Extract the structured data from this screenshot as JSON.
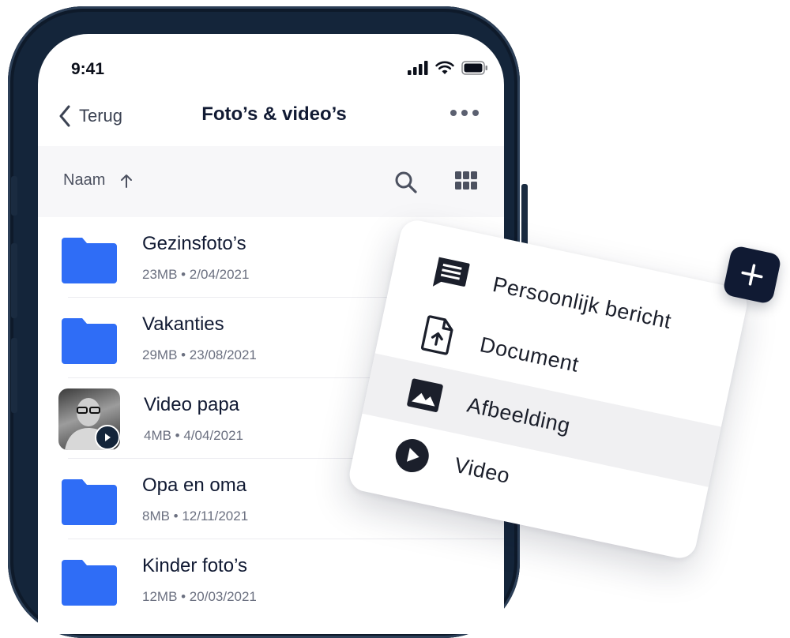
{
  "status_bar": {
    "time": "9:41"
  },
  "nav": {
    "back_label": "Terug",
    "title": "Foto’s & video’s"
  },
  "sort": {
    "label": "Naam"
  },
  "files": [
    {
      "name": "Gezinsfoto’s",
      "meta": "23MB • 2/04/2021",
      "type": "folder"
    },
    {
      "name": "Vakanties",
      "meta": "29MB • 23/08/2021",
      "type": "folder"
    },
    {
      "name": "Video papa",
      "meta": "4MB • 4/04/2021",
      "type": "video"
    },
    {
      "name": "Opa en oma",
      "meta": "8MB • 12/11/2021",
      "type": "folder"
    },
    {
      "name": "Kinder foto’s",
      "meta": "12MB • 20/03/2021",
      "type": "folder"
    }
  ],
  "add_menu": {
    "items": [
      {
        "label": "Persoonlijk bericht",
        "icon": "message-icon"
      },
      {
        "label": "Document",
        "icon": "document-upload-icon"
      },
      {
        "label": "Afbeelding",
        "icon": "image-icon"
      },
      {
        "label": "Video",
        "icon": "play-circle-icon"
      }
    ],
    "active_index": 2
  },
  "colors": {
    "accent": "#2f6df6",
    "dark": "#101a33",
    "frame": "#14253a"
  }
}
